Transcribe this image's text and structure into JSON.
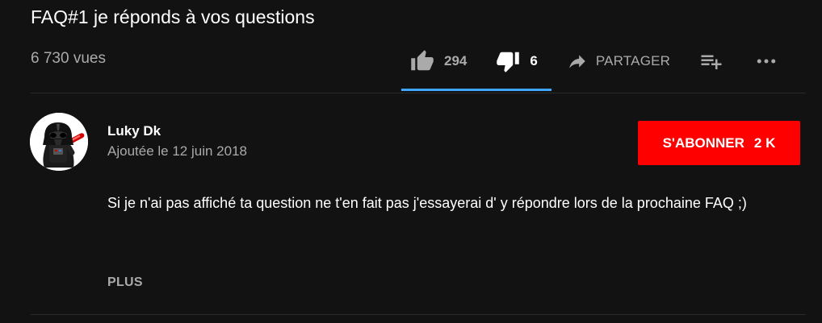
{
  "video": {
    "title": "FAQ#1 je réponds à vos questions",
    "views": "6 730 vues"
  },
  "actions": {
    "like_count": "294",
    "dislike_count": "6",
    "share_label": "PARTAGER",
    "like_icon": "thumb-up-icon",
    "dislike_icon": "thumb-down-icon",
    "share_icon": "share-arrow-icon",
    "save_icon": "add-to-playlist-icon",
    "more_icon": "more-horizontal-icon"
  },
  "sentiment": {
    "like_ratio": 0.98,
    "color": "#3ea6ff"
  },
  "channel": {
    "name": "Luky Dk",
    "published": "Ajoutée le 12 juin 2018"
  },
  "subscribe": {
    "label": "S'ABONNER",
    "count": "2 K",
    "color": "#ff0000"
  },
  "description": {
    "text": "Si je n'ai pas affiché ta question ne t'en fait pas j'essayerai d' y répondre lors de la prochaine FAQ ;)",
    "more_label": "PLUS"
  }
}
